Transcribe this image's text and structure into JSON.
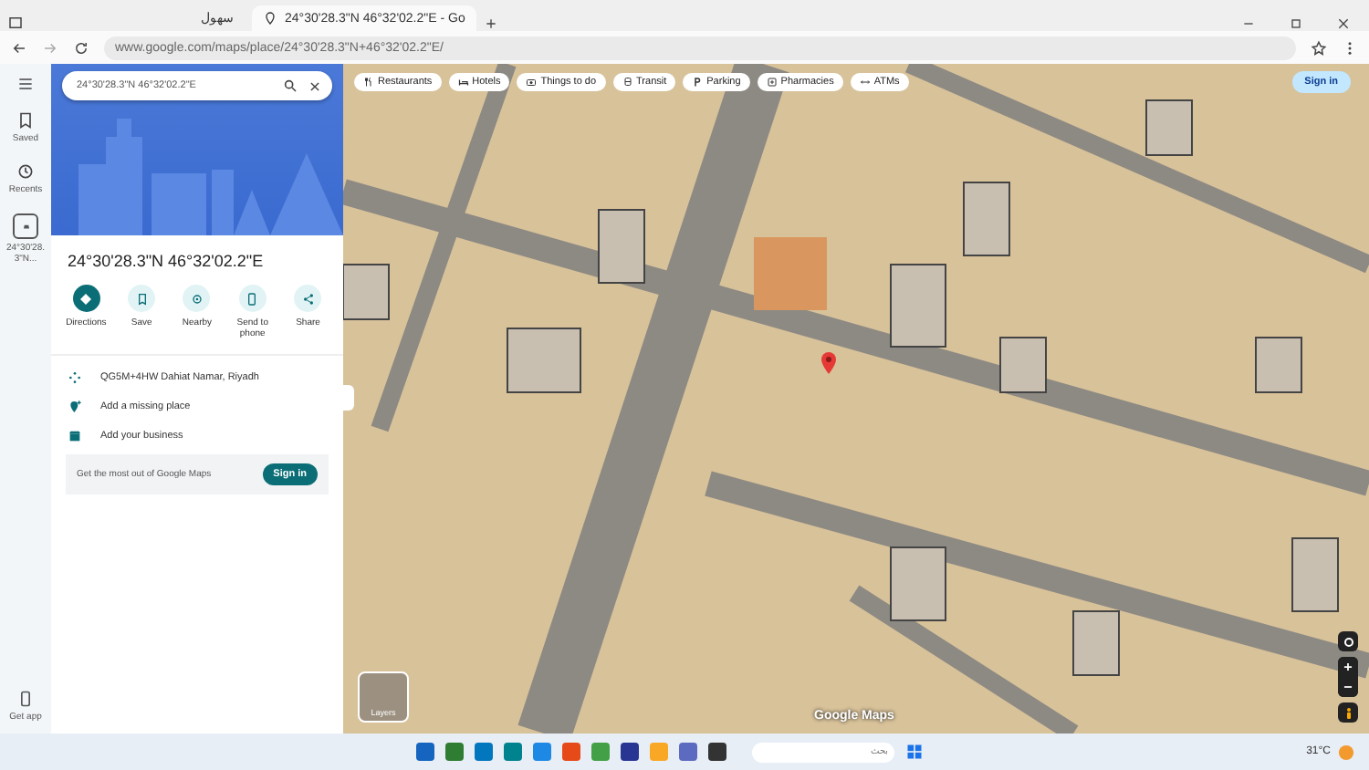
{
  "browser": {
    "tabs": [
      {
        "title": "سهول",
        "selected": false
      },
      {
        "title": "24°30'28.3\"N 46°32'02.2\"E - Go",
        "selected": true
      }
    ],
    "url": "www.google.com/maps/place/24°30'28.3\"N+46°32'02.2\"E/"
  },
  "rail": {
    "items": [
      {
        "kind": "saved",
        "label": "Saved"
      },
      {
        "kind": "recents",
        "label": "Recents"
      }
    ],
    "recent_place": "24°30'28.3\"N...",
    "get_app": "Get app"
  },
  "panel": {
    "search_value": "24°30'28.3\"N 46°32'02.2\"E",
    "title": "24°30'28.3\"N 46°32'02.2\"E",
    "actions": [
      {
        "kind": "directions",
        "label": "Directions",
        "primary": true
      },
      {
        "kind": "save",
        "label": "Save",
        "primary": false
      },
      {
        "kind": "nearby",
        "label": "Nearby",
        "primary": false
      },
      {
        "kind": "phone",
        "label": "Send to phone",
        "primary": false
      },
      {
        "kind": "share",
        "label": "Share",
        "primary": false
      }
    ],
    "details": [
      {
        "kind": "plus_code",
        "text": "QG5M+4HW Dahiat Namar, Riyadh"
      },
      {
        "kind": "add_place",
        "text": "Add a missing place"
      },
      {
        "kind": "business",
        "text": "Add your business"
      }
    ],
    "promo": {
      "text": "Get the most out of Google Maps",
      "button": "Sign in"
    }
  },
  "map": {
    "chips": [
      {
        "kind": "restaurants",
        "label": "Restaurants"
      },
      {
        "kind": "hotels",
        "label": "Hotels"
      },
      {
        "kind": "things",
        "label": "Things to do"
      },
      {
        "kind": "transit",
        "label": "Transit"
      },
      {
        "kind": "parking",
        "label": "Parking"
      },
      {
        "kind": "pharmacies",
        "label": "Pharmacies"
      },
      {
        "kind": "atms",
        "label": "ATMs"
      }
    ],
    "sign_in": "Sign in",
    "layers": "Layers",
    "logo": "Google Maps"
  },
  "taskbar": {
    "search_placeholder": "بحث",
    "weather": "31°C"
  }
}
